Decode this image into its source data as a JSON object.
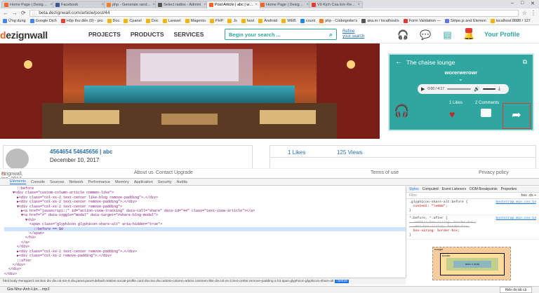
{
  "browser": {
    "tabs": [
      {
        "label": "Home Page | DesignWa",
        "color": "#f26522",
        "active": false
      },
      {
        "label": "Facebook",
        "color": "#3b5998",
        "active": false
      },
      {
        "label": "php - Generate random",
        "color": "#f48024",
        "active": false
      },
      {
        "label": "Select radios - Admini",
        "color": "#555555",
        "active": false
      },
      {
        "label": "Post Article | abc | weru",
        "color": "#f26522",
        "active": true
      },
      {
        "label": "Home Page | DesignWa",
        "color": "#f26522",
        "active": false
      },
      {
        "label": "Vũ Kịch Của Em Remix",
        "color": "#e53935",
        "active": false
      }
    ],
    "url": "beta.dezignwall.com/article/post/44",
    "bookmarks": [
      {
        "label": "Ứng dụng",
        "color": "#4285f4"
      },
      {
        "label": "Google Dịch",
        "color": "#4285f4"
      },
      {
        "label": "Hộp thư đến (9) - pro",
        "color": "#ea4335"
      },
      {
        "label": "Doc",
        "color": "#f4b400"
      },
      {
        "label": "Cpanel",
        "color": "#f4b400"
      },
      {
        "label": "Doc",
        "color": "#f4b400"
      },
      {
        "label": "Laravel",
        "color": "#f4b400"
      },
      {
        "label": "Magento",
        "color": "#f4b400"
      },
      {
        "label": "PHP",
        "color": "#f4b400"
      },
      {
        "label": "Js",
        "color": "#f4b400"
      },
      {
        "label": "host",
        "color": "#f4b400"
      },
      {
        "label": "Android",
        "color": "#f4b400"
      },
      {
        "label": "WEB",
        "color": "#f4b400"
      },
      {
        "label": "count",
        "color": "#1e88e5"
      },
      {
        "label": "php - Codeigniter's",
        "color": "#f48024"
      },
      {
        "label": "aka.m / localhost/s",
        "color": "#555555"
      },
      {
        "label": "Form Validation —",
        "color": "#e53935"
      },
      {
        "label": "Stripe.js and Elemen",
        "color": "#6772e5"
      },
      {
        "label": "localhost:8888 / 127",
        "color": "#f4b400"
      }
    ]
  },
  "site": {
    "logo_d": "d",
    "logo_rest": "ezignwall",
    "nav": [
      "PROJECTS",
      "PRODUCTS",
      "SERVICES"
    ],
    "search_placeholder": "Begin your search ...",
    "refine_1": "Refine",
    "refine_2": "your search",
    "notif_count": "",
    "your_profile": "Your Profile"
  },
  "player": {
    "title": "The chaise lounge",
    "author": "worerwerowr",
    "time": "0:00 / 4:17",
    "likes_label": "1 Likes",
    "comments_label": "2 Comments"
  },
  "post": {
    "user_name": "4564654 54645656 | abc",
    "date": "December 10, 2017",
    "likes": "1 Likes",
    "views": "125 Views"
  },
  "footer": {
    "copyright_d": "D",
    "copyright_rest": "ezignwall, Inc. 2017",
    "about": "About us",
    "contact": "Contact",
    "upgrade": "Upgrade",
    "terms": "Terms of use",
    "privacy": "Privacy policy"
  },
  "devtools": {
    "tabs": [
      "Elements",
      "Console",
      "Sources",
      "Network",
      "Performance",
      "Memory",
      "Application",
      "Security",
      "Audits"
    ],
    "styles_tabs": [
      "Styles",
      "Computed",
      "Event Listeners",
      "DOM Breakpoints",
      "Properties"
    ],
    "filter": "Filter",
    "filter_right": ":hov .cls +",
    "dom_lines": [
      "      ::before",
      "    ▼<div class=\"custom-column-article commen-like\">",
      "      ▶<div class=\"col-xs-2 text-center like-blog remove-padding\">…</div>",
      "      ▶<div class=\"col-xs-2 text-center remove-padding\">…</div>",
      "      ▼<div class=\"col-xs-2 text-center remove-padding\">",
      "        ▶<a href=\"javascript:;\" id=\"action-view-tracking\" data-call=\"share\" data-id=\"44\" class=\"text-view-article\"></a>",
      "        ▼<a href=\"#\" data-toggle=\"modal\" data-target=\"#share-blog-modal\">",
      "          ▼<h3>",
      "            <span class=\"glyphicon glyphicon-share-alt\" aria-hidden=\"true\">",
      "              ::before == $0",
      "            </span>",
      "          </h3>",
      "        </a>",
      "      </div>",
      "      ▶<div class=\"col-xs-2 text-center remove-padding\">…</div>",
      "      ▶<div class=\"col-xs-2 remove-padding\">…</div>",
      "      ::after",
      "    </div>",
      "  </div>",
      "</div>"
    ],
    "rule1_selector": ".glyphicon-share-alt:before {",
    "rule1_prop": "  content: \"\\e095\";",
    "rule1_src": "bootstrap.min.css:14",
    "rule2_selector": "*:before, *:after {",
    "rule2_prop1": "  -webkit-box-sizing: border-box;",
    "rule2_prop2": "  -moz-box-sizing: border-box;",
    "rule2_prop3": "  box-sizing: border-box;",
    "rule2_src": "bootstrap.min.css:14",
    "box_margin": "margin",
    "box_border": "border",
    "box_content": "auto × auto",
    "breadcrumb": "html  body  #wrapper2  section  div  div.col-sm-6  div.panel.panel-default.relative.social-profile.card  div.row  div.custom-column-article.commen-like  div.col-xs-2.text-center.remove-padding  a  h3  span.glyphicon.glyphicon-share-alt",
    "breadcrumb_current": "::before"
  },
  "downloads": {
    "file": "Gia-Như-Anh-Lặn....mp3",
    "show_all": "Hiển thị tất cả"
  },
  "colors": {
    "accent": "#2fa7a0",
    "brand_orange": "#f26522",
    "link_blue": "#2a6fa8",
    "heart_red": "#c62828"
  }
}
